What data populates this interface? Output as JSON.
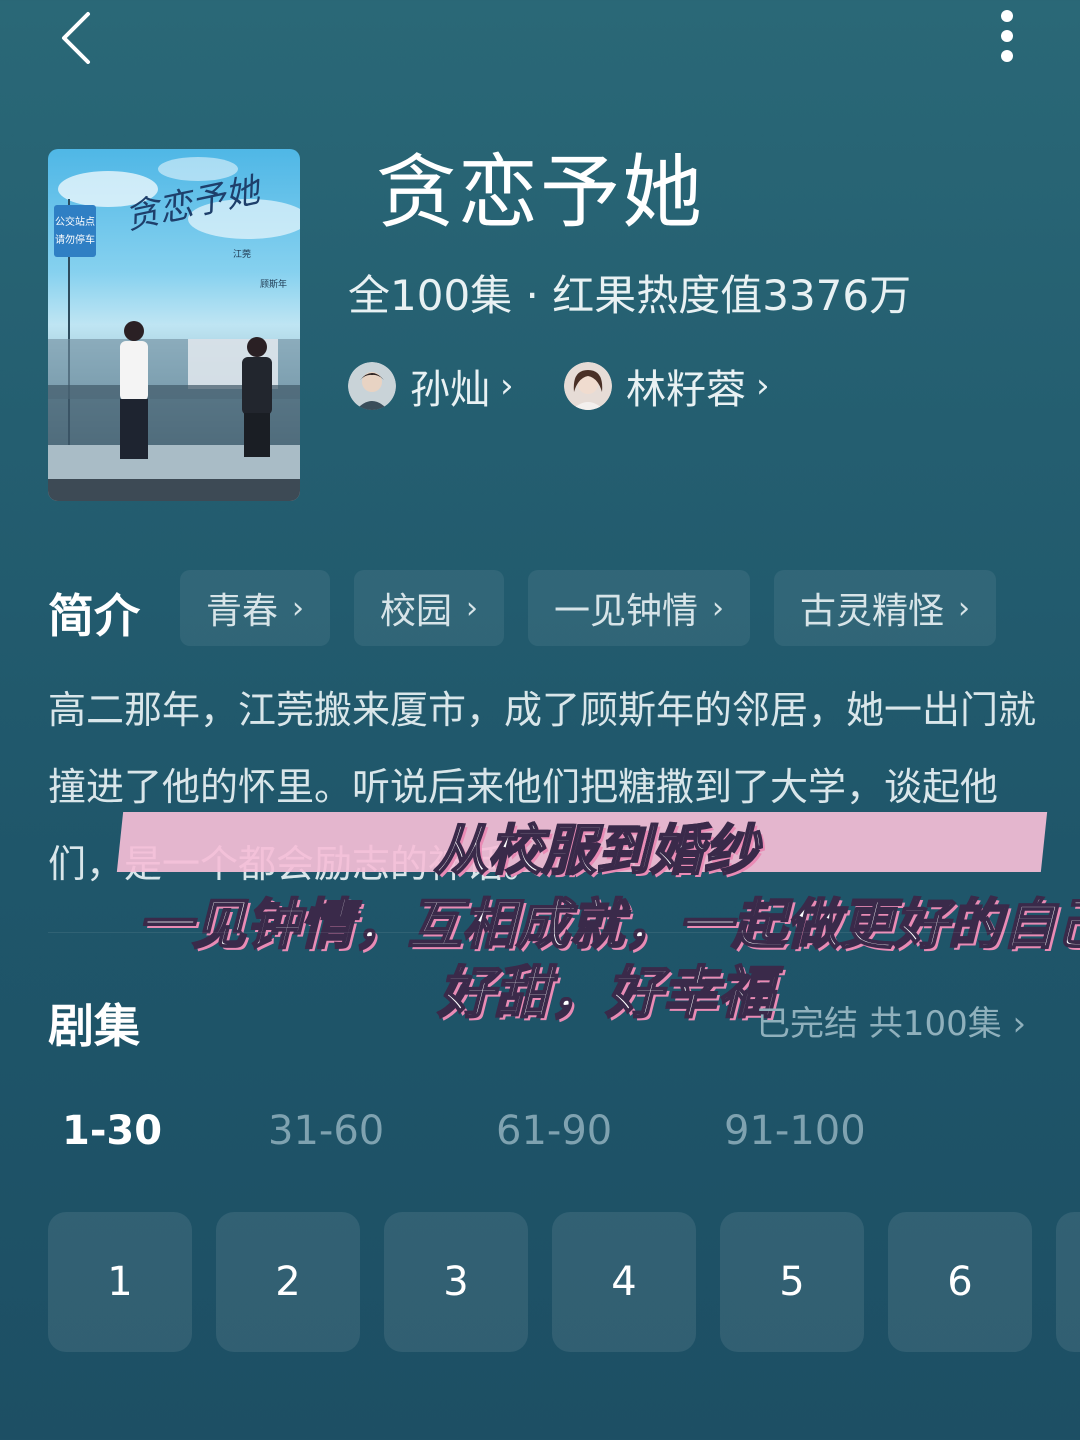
{
  "header": {
    "back_icon": "chevron-left-icon",
    "more_icon": "more-vertical-icon"
  },
  "drama": {
    "title": "贪恋予她",
    "meta": "全100集 · 红果热度值3376万",
    "cast": [
      {
        "name": "孙灿",
        "chevron": "›"
      },
      {
        "name": "林籽蓉",
        "chevron": "›"
      }
    ],
    "poster": {
      "title_art": "贪恋予她",
      "sign_line1": "公交站点",
      "sign_line2": "请勿停车",
      "actor1": "江莞",
      "actor2": "顾斯年"
    }
  },
  "synopsis": {
    "heading": "简介",
    "tags": [
      {
        "label": "青春",
        "chevron": "›"
      },
      {
        "label": "校园",
        "chevron": "›"
      },
      {
        "label": "一见钟情",
        "chevron": "›"
      },
      {
        "label": "古灵精怪",
        "chevron": "›"
      }
    ],
    "text": "高二那年，江莞搬来厦市，成了顾斯年的邻居，她一出门就撞进了他的怀里。听说后来他们把糖撒到了大学，谈起他们，是一个都会励志的神话。"
  },
  "overlay_captions": [
    "从校服到婚纱",
    "一见钟情，互相成就，一起做更好的自己",
    "好甜，好幸福"
  ],
  "episodes": {
    "heading": "剧集",
    "status": "已完结 共100集",
    "status_chevron": "›",
    "ranges": [
      "1-30",
      "31-60",
      "61-90",
      "91-100"
    ],
    "active_range": "1-30",
    "items": [
      "1",
      "2",
      "3",
      "4",
      "5",
      "6"
    ]
  },
  "colors": {
    "background_top": "#2a6877",
    "background_bottom": "#1d4f64",
    "caption_band": "#f5bed7",
    "muted_text": "#7fa2b0"
  }
}
